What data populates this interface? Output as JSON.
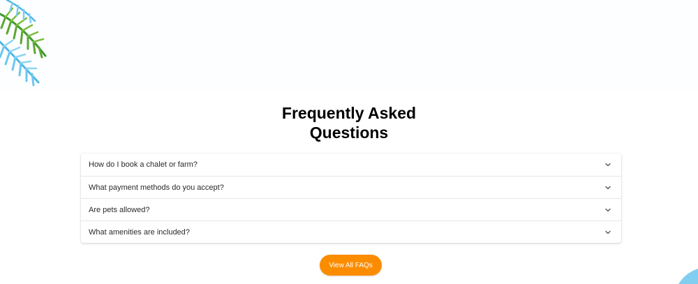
{
  "faq": {
    "title_line1": "Frequently Asked",
    "title_line2": "Questions",
    "items": [
      {
        "question": "How do I book a chalet or farm?",
        "icon": "chevron-down-icon"
      },
      {
        "question": "What payment methods do you accept?",
        "icon": "chevron-down-icon"
      },
      {
        "question": "Are pets allowed?",
        "icon": "chevron-down-icon"
      },
      {
        "question": "What amenities are included?",
        "icon": "chevron-down-icon"
      }
    ],
    "view_all_label": "View All FAQs"
  },
  "colors": {
    "accent": "#fb8c00",
    "palm_green": "#3f9a2e",
    "palm_blue": "#4cb8e8"
  }
}
